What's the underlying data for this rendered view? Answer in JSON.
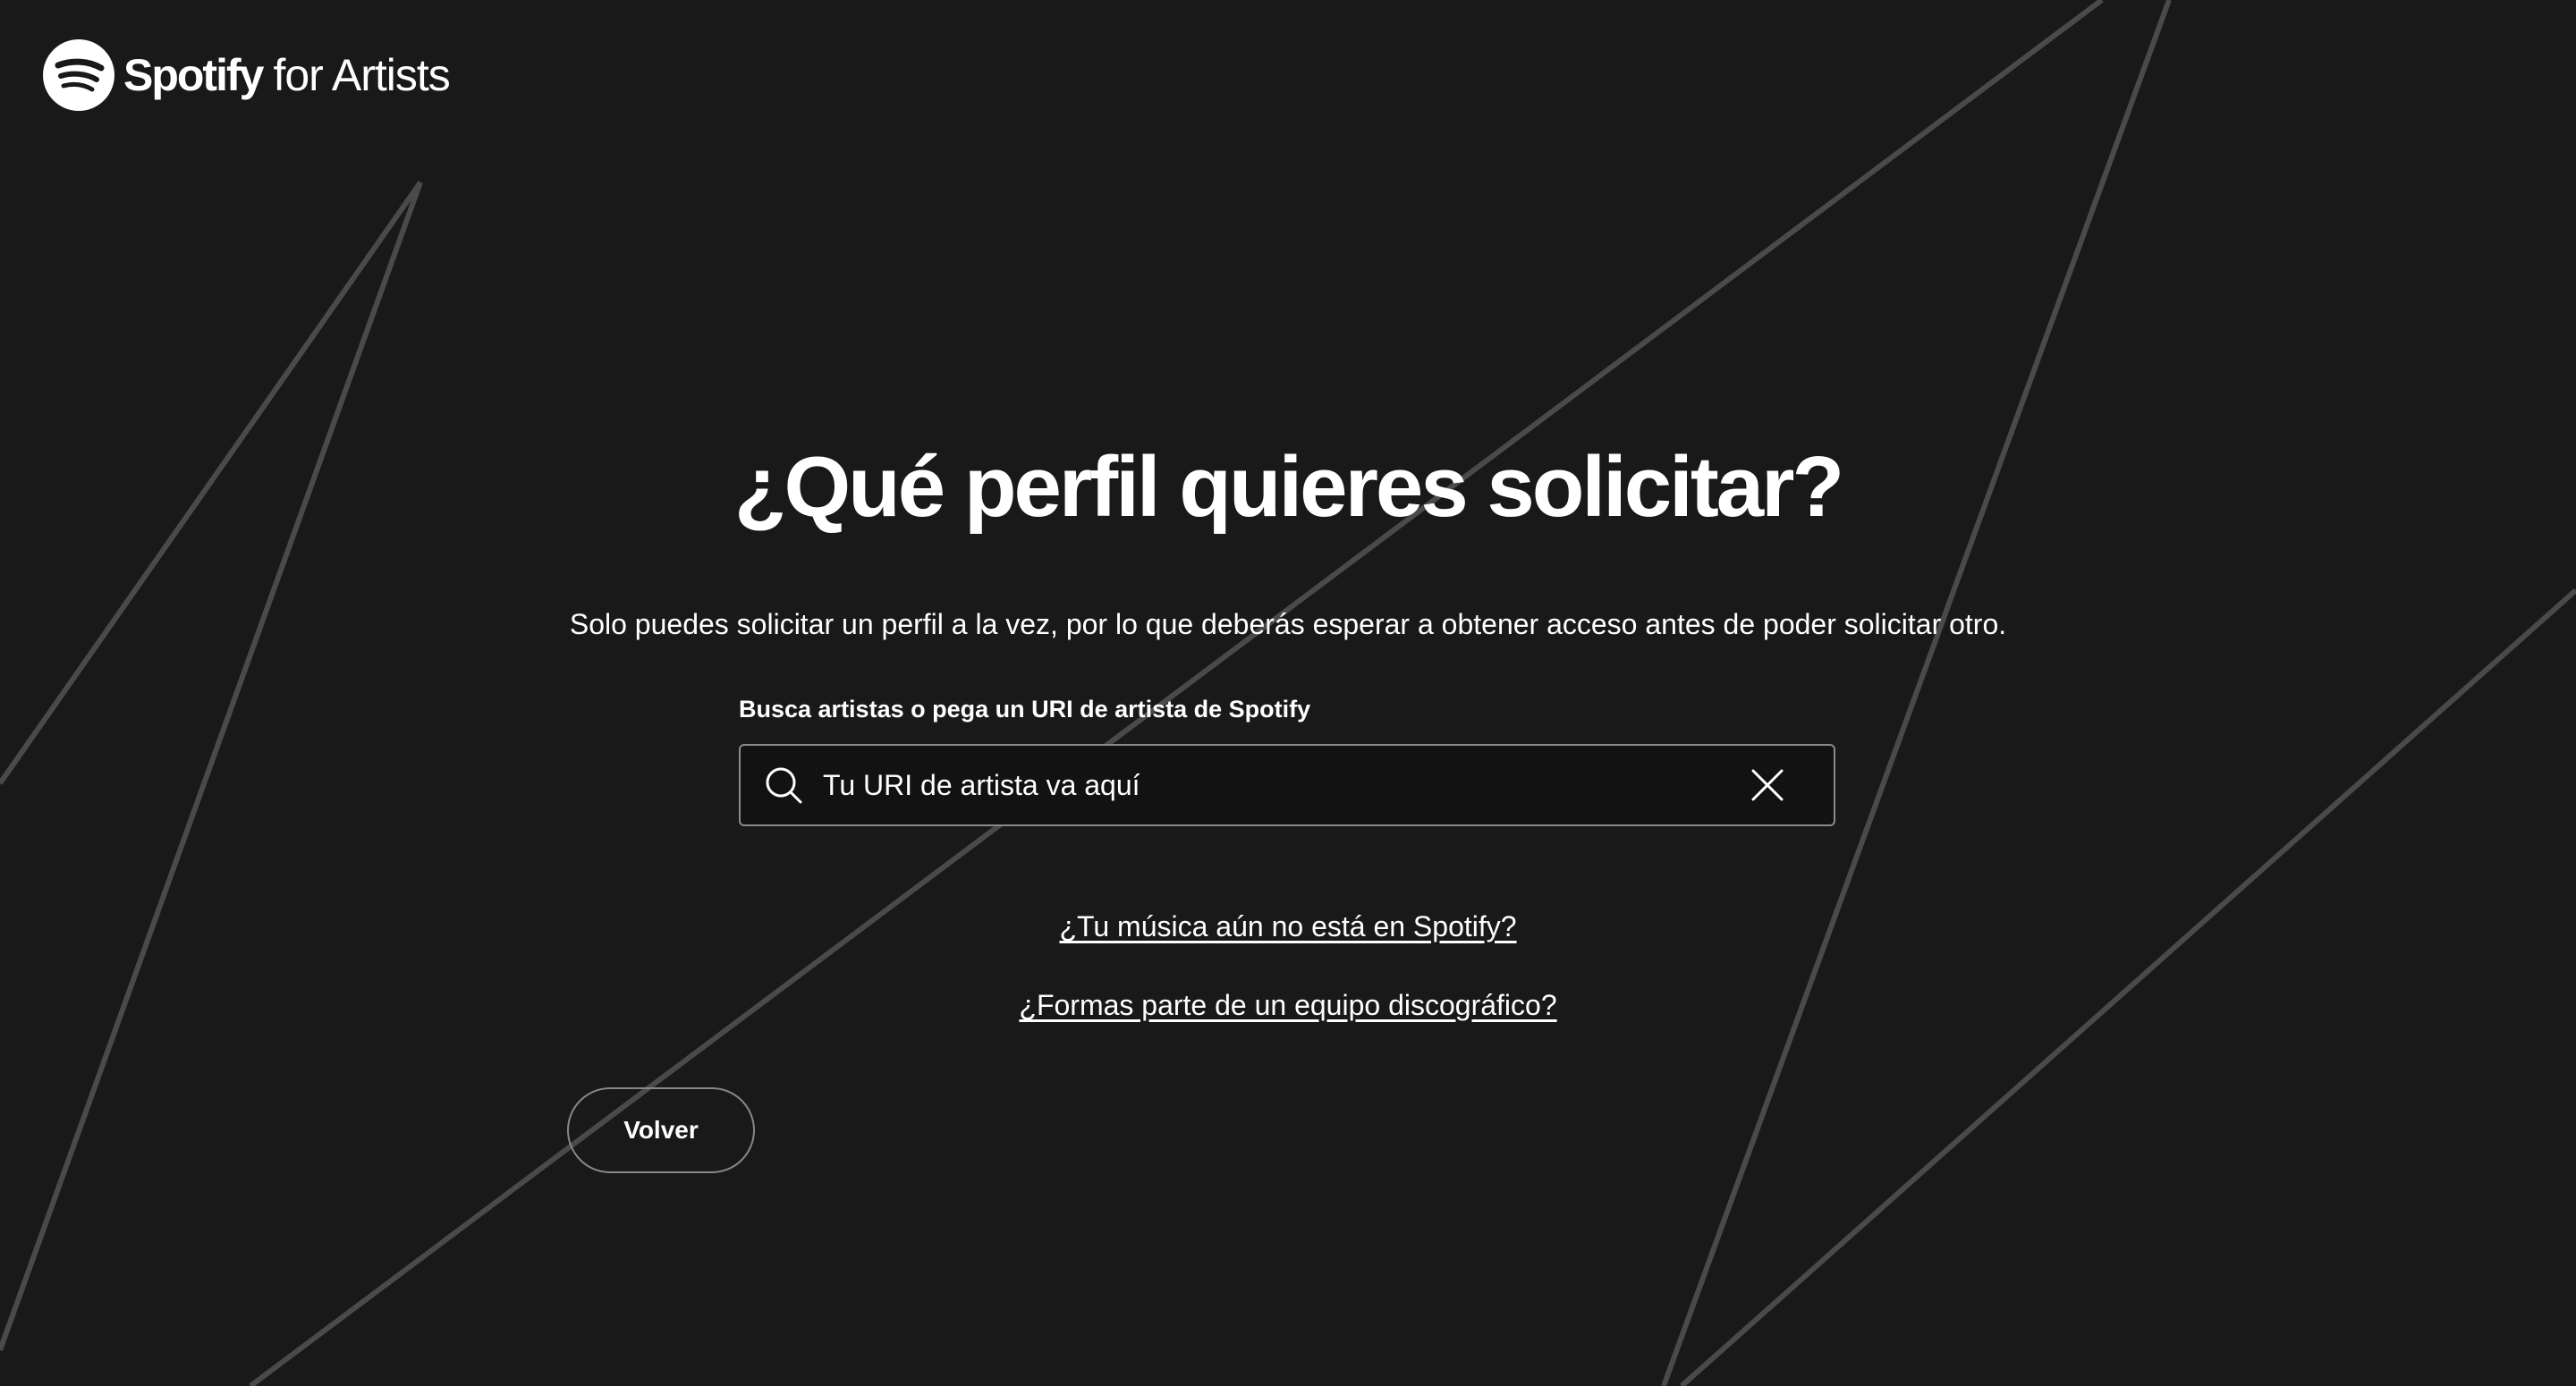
{
  "header": {
    "logo_brand": "Spotify",
    "logo_suffix": "for Artists",
    "logo_icon": "spotify-logo-icon"
  },
  "main": {
    "title": "¿Qué perfil quieres solicitar?",
    "subtitle": "Solo puedes solicitar un perfil a la vez, por lo que deberás esperar a obtener acceso antes de poder solicitar otro.",
    "search": {
      "label": "Busca artistas o pega un URI de artista de Spotify",
      "value": "",
      "placeholder": "Tu URI de artista va aquí",
      "search_icon": "search-icon",
      "clear_icon": "close-icon"
    },
    "links": [
      {
        "label": "¿Tu música aún no está en Spotify?"
      },
      {
        "label": "¿Formas parte de un equipo discográfico?"
      }
    ],
    "back_button": "Volver"
  },
  "colors": {
    "background": "#191919",
    "decorative_lines": "#4a4a4a",
    "text": "#ffffff",
    "input_background": "#121212",
    "input_border": "#8a8a8a"
  }
}
